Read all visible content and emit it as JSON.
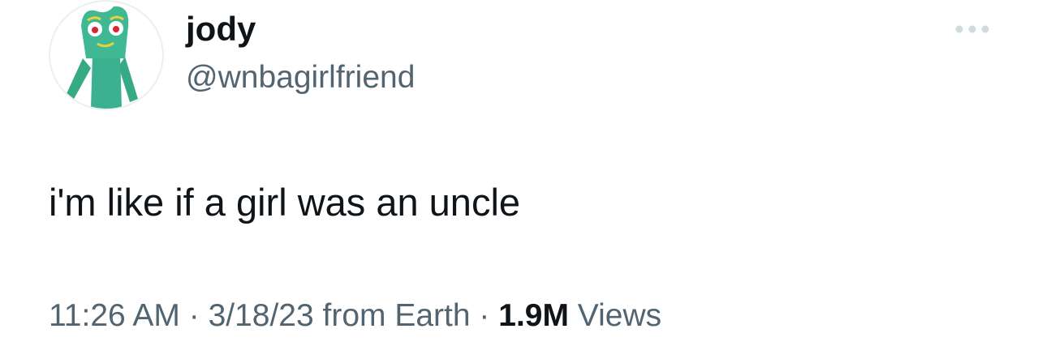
{
  "tweet": {
    "author": {
      "display_name": "jody",
      "handle": "@wnbagirlfriend",
      "avatar_icon": "gumby-avatar"
    },
    "more_icon": "more-dots-icon",
    "text": "i'm like if a girl was an uncle",
    "meta": {
      "time": "11:26 AM",
      "separator1": " · ",
      "date": "3/18/23",
      "source": " from Earth",
      "separator2": " · ",
      "views_count": "1.9M",
      "views_label": " Views"
    }
  },
  "colors": {
    "text_primary": "#0f1419",
    "text_secondary": "#536471",
    "more_dots": "#cfd9de",
    "avatar_green": "#3bb18f"
  }
}
